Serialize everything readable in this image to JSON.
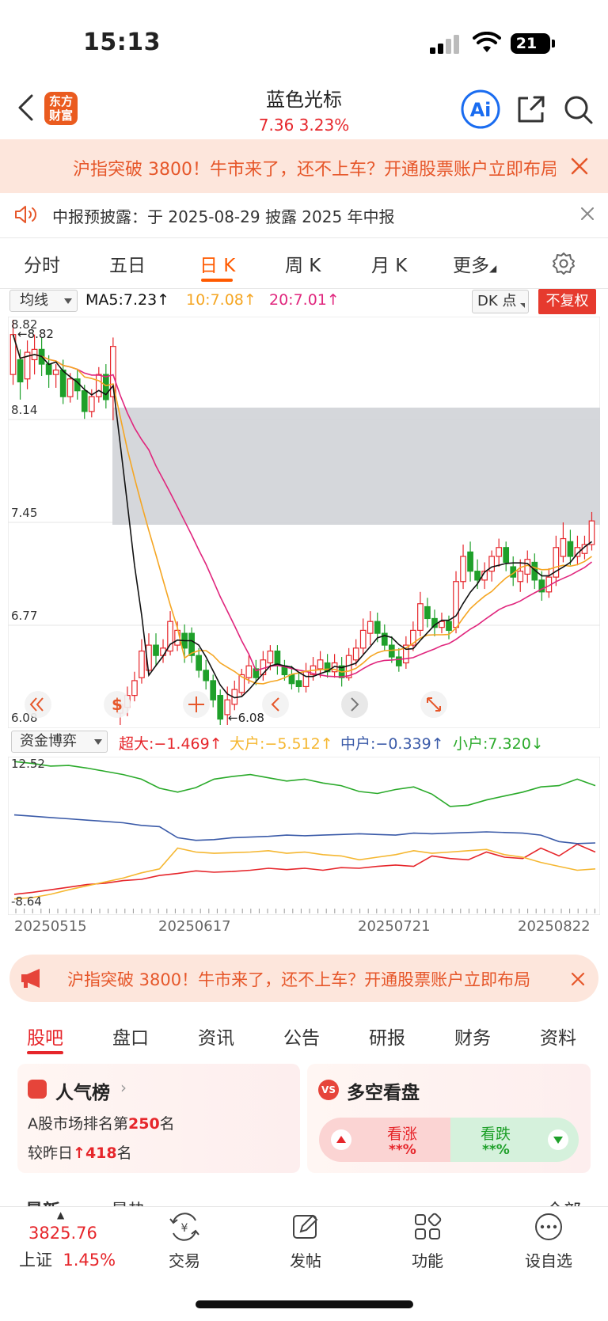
{
  "status_bar": {
    "time": "15:13",
    "battery": "21"
  },
  "header": {
    "logo_text_line1": "东方",
    "logo_text_line2": "财富",
    "title": "蓝色光标",
    "price": "7.36  3.23%",
    "ai_label": "Ai"
  },
  "banner": {
    "text": "沪指突破 3800！牛市来了，还不上车？开通股票账户立即布局"
  },
  "notice": {
    "text": "中报预披露：于 2025-08-29 披露 2025 年中报"
  },
  "chart_tabs": [
    {
      "label": "分时"
    },
    {
      "label": "五日"
    },
    {
      "label": "日 K"
    },
    {
      "label": "周 K"
    },
    {
      "label": "月 K"
    },
    {
      "label": "更多"
    }
  ],
  "ma_row": {
    "select": "均线",
    "ma5": "MA5:7.23↑",
    "ma10": "10:7.08↑",
    "ma20": "20:7.01↑",
    "dk": "DK 点",
    "adjust": "不复权"
  },
  "kline_labels": {
    "y_ticks": [
      "8.82",
      "8.14",
      "7.45",
      "6.77",
      "6.08"
    ],
    "high_marker": "←8.82",
    "low_marker": "←6.08"
  },
  "capital_row": {
    "select": "资金博弈",
    "super": "超大:−1.469↑",
    "large": "大户:−5.512↑",
    "medium": "中户:−0.339↑",
    "small": "小户:7.320↓"
  },
  "capital_labels": {
    "y_max": "12.52",
    "y_min": "-8.64"
  },
  "dates": [
    "20250515",
    "20250617",
    "20250721",
    "20250822"
  ],
  "colors": {
    "up": "#e6262b",
    "down": "#1fa02a",
    "ma5": "#111111",
    "ma10": "#f5a623",
    "ma20": "#e0267d",
    "super": "#e6262b",
    "large": "#f5b731",
    "medium": "#3a5aa8",
    "small": "#2aaa2a",
    "accent": "#ff5a00"
  },
  "chart_data": [
    {
      "type": "candlestick",
      "title": "",
      "ylim": [
        6.08,
        8.82
      ],
      "y_ticks": [
        8.82,
        8.14,
        7.45,
        6.77,
        6.08
      ],
      "x_ticks": [
        "20250515",
        "20250617",
        "20250721",
        "20250822"
      ],
      "candles": [
        {
          "o": 8.45,
          "c": 8.72,
          "h": 8.82,
          "l": 8.38
        },
        {
          "o": 8.55,
          "c": 8.4,
          "h": 8.62,
          "l": 8.28
        },
        {
          "o": 8.42,
          "c": 8.6,
          "h": 8.68,
          "l": 8.35
        },
        {
          "o": 8.55,
          "c": 8.62,
          "h": 8.72,
          "l": 8.45
        },
        {
          "o": 8.62,
          "c": 8.52,
          "h": 8.7,
          "l": 8.44
        },
        {
          "o": 8.52,
          "c": 8.45,
          "h": 8.58,
          "l": 8.36
        },
        {
          "o": 8.45,
          "c": 8.48,
          "h": 8.52,
          "l": 8.36
        },
        {
          "o": 8.48,
          "c": 8.3,
          "h": 8.55,
          "l": 8.25
        },
        {
          "o": 8.3,
          "c": 8.42,
          "h": 8.46,
          "l": 8.26
        },
        {
          "o": 8.42,
          "c": 8.34,
          "h": 8.48,
          "l": 8.28
        },
        {
          "o": 8.34,
          "c": 8.2,
          "h": 8.38,
          "l": 8.15
        },
        {
          "o": 8.2,
          "c": 8.3,
          "h": 8.35,
          "l": 8.16
        },
        {
          "o": 8.3,
          "c": 8.45,
          "h": 8.5,
          "l": 8.26
        },
        {
          "o": 8.45,
          "c": 8.28,
          "h": 8.52,
          "l": 8.22
        },
        {
          "o": 8.3,
          "c": 8.64,
          "h": 8.7,
          "l": 8.14
        },
        {
          "o": 6.16,
          "c": 6.22,
          "h": 6.26,
          "l": 6.08
        },
        {
          "o": 6.2,
          "c": 6.28,
          "h": 6.34,
          "l": 6.14
        },
        {
          "o": 6.28,
          "c": 6.38,
          "h": 6.44,
          "l": 6.24
        },
        {
          "o": 6.4,
          "c": 6.58,
          "h": 6.66,
          "l": 6.36
        },
        {
          "o": 6.45,
          "c": 6.62,
          "h": 6.7,
          "l": 6.42
        },
        {
          "o": 6.62,
          "c": 6.55,
          "h": 6.7,
          "l": 6.48
        },
        {
          "o": 6.55,
          "c": 6.6,
          "h": 6.66,
          "l": 6.5
        },
        {
          "o": 6.58,
          "c": 6.78,
          "h": 6.85,
          "l": 6.55
        },
        {
          "o": 6.62,
          "c": 6.72,
          "h": 6.78,
          "l": 6.58
        },
        {
          "o": 6.7,
          "c": 6.6,
          "h": 6.76,
          "l": 6.5
        },
        {
          "o": 6.7,
          "c": 6.55,
          "h": 6.74,
          "l": 6.5
        },
        {
          "o": 6.55,
          "c": 6.45,
          "h": 6.6,
          "l": 6.4
        },
        {
          "o": 6.45,
          "c": 6.38,
          "h": 6.52,
          "l": 6.32
        },
        {
          "o": 6.38,
          "c": 6.25,
          "h": 6.42,
          "l": 6.2
        },
        {
          "o": 6.28,
          "c": 6.12,
          "h": 6.32,
          "l": 6.08
        },
        {
          "o": 6.15,
          "c": 6.25,
          "h": 6.34,
          "l": 6.08
        },
        {
          "o": 6.22,
          "c": 6.32,
          "h": 6.38,
          "l": 6.18
        },
        {
          "o": 6.3,
          "c": 6.42,
          "h": 6.46,
          "l": 6.28
        },
        {
          "o": 6.4,
          "c": 6.48,
          "h": 6.55,
          "l": 6.36
        },
        {
          "o": 6.46,
          "c": 6.4,
          "h": 6.52,
          "l": 6.35
        },
        {
          "o": 6.42,
          "c": 6.52,
          "h": 6.58,
          "l": 6.38
        },
        {
          "o": 6.5,
          "c": 6.58,
          "h": 6.62,
          "l": 6.45
        },
        {
          "o": 6.58,
          "c": 6.48,
          "h": 6.62,
          "l": 6.42
        },
        {
          "o": 6.48,
          "c": 6.42,
          "h": 6.52,
          "l": 6.38
        },
        {
          "o": 6.42,
          "c": 6.36,
          "h": 6.48,
          "l": 6.32
        },
        {
          "o": 6.38,
          "c": 6.34,
          "h": 6.44,
          "l": 6.3
        },
        {
          "o": 6.34,
          "c": 6.44,
          "h": 6.5,
          "l": 6.3
        },
        {
          "o": 6.42,
          "c": 6.48,
          "h": 6.54,
          "l": 6.38
        },
        {
          "o": 6.46,
          "c": 6.52,
          "h": 6.58,
          "l": 6.4
        },
        {
          "o": 6.5,
          "c": 6.44,
          "h": 6.56,
          "l": 6.4
        },
        {
          "o": 6.44,
          "c": 6.5,
          "h": 6.56,
          "l": 6.4
        },
        {
          "o": 6.48,
          "c": 6.4,
          "h": 6.54,
          "l": 6.34
        },
        {
          "o": 6.4,
          "c": 6.55,
          "h": 6.6,
          "l": 6.38
        },
        {
          "o": 6.52,
          "c": 6.6,
          "h": 6.66,
          "l": 6.48
        },
        {
          "o": 6.6,
          "c": 6.72,
          "h": 6.8,
          "l": 6.56
        },
        {
          "o": 6.7,
          "c": 6.78,
          "h": 6.85,
          "l": 6.62
        },
        {
          "o": 6.78,
          "c": 6.7,
          "h": 6.84,
          "l": 6.64
        },
        {
          "o": 6.7,
          "c": 6.62,
          "h": 6.76,
          "l": 6.58
        },
        {
          "o": 6.62,
          "c": 6.54,
          "h": 6.68,
          "l": 6.5
        },
        {
          "o": 6.54,
          "c": 6.48,
          "h": 6.6,
          "l": 6.44
        },
        {
          "o": 6.5,
          "c": 6.62,
          "h": 6.68,
          "l": 6.46
        },
        {
          "o": 6.62,
          "c": 6.72,
          "h": 6.78,
          "l": 6.58
        },
        {
          "o": 6.72,
          "c": 6.9,
          "h": 6.98,
          "l": 6.68
        },
        {
          "o": 6.88,
          "c": 6.8,
          "h": 6.94,
          "l": 6.74
        },
        {
          "o": 6.8,
          "c": 6.74,
          "h": 6.86,
          "l": 6.68
        },
        {
          "o": 6.74,
          "c": 6.78,
          "h": 6.84,
          "l": 6.7
        },
        {
          "o": 6.78,
          "c": 6.72,
          "h": 6.82,
          "l": 6.66
        },
        {
          "o": 6.74,
          "c": 7.05,
          "h": 7.12,
          "l": 6.7
        },
        {
          "o": 7.05,
          "c": 7.22,
          "h": 7.3,
          "l": 7.0
        },
        {
          "o": 7.25,
          "c": 7.12,
          "h": 7.32,
          "l": 7.05
        },
        {
          "o": 7.12,
          "c": 7.06,
          "h": 7.2,
          "l": 7.0
        },
        {
          "o": 7.06,
          "c": 7.12,
          "h": 7.18,
          "l": 7.0
        },
        {
          "o": 7.12,
          "c": 7.22,
          "h": 7.26,
          "l": 7.05
        },
        {
          "o": 7.22,
          "c": 7.28,
          "h": 7.34,
          "l": 7.15
        },
        {
          "o": 7.28,
          "c": 7.18,
          "h": 7.32,
          "l": 7.12
        },
        {
          "o": 7.15,
          "c": 7.08,
          "h": 7.22,
          "l": 7.02
        },
        {
          "o": 7.05,
          "c": 7.12,
          "h": 7.2,
          "l": 6.98
        },
        {
          "o": 7.1,
          "c": 7.2,
          "h": 7.26,
          "l": 7.04
        },
        {
          "o": 7.18,
          "c": 7.06,
          "h": 7.24,
          "l": 7.0
        },
        {
          "o": 7.06,
          "c": 6.98,
          "h": 7.12,
          "l": 6.92
        },
        {
          "o": 6.98,
          "c": 7.08,
          "h": 7.14,
          "l": 6.94
        },
        {
          "o": 7.08,
          "c": 7.28,
          "h": 7.36,
          "l": 7.02
        },
        {
          "o": 7.22,
          "c": 7.34,
          "h": 7.45,
          "l": 7.18
        },
        {
          "o": 7.32,
          "c": 7.22,
          "h": 7.4,
          "l": 7.16
        },
        {
          "o": 7.22,
          "c": 7.28,
          "h": 7.36,
          "l": 7.16
        },
        {
          "o": 7.24,
          "c": 7.3,
          "h": 7.36,
          "l": 7.2
        },
        {
          "o": 7.3,
          "c": 7.46,
          "h": 7.52,
          "l": 7.26
        }
      ]
    },
    {
      "type": "line",
      "title": "资金博弈",
      "ylim": [
        -8.64,
        12.52
      ],
      "x_ticks": [
        "20250515",
        "20250617",
        "20250721",
        "20250822"
      ],
      "series": [
        {
          "name": "超大",
          "values": [
            -7.9,
            -7.6,
            -7.2,
            -6.8,
            -6.4,
            -6.2,
            -5.8,
            -5.6,
            -5.0,
            -4.7,
            -4.3,
            -4.5,
            -4.4,
            -4.2,
            -3.9,
            -4.1,
            -3.9,
            -4.2,
            -3.8,
            -3.9,
            -3.6,
            -3.4,
            -3.6,
            -2.0,
            -2.4,
            -2.6,
            -1.4,
            -2.2,
            -2.4,
            -0.8,
            -2.0,
            -0.2,
            -1.4
          ]
        },
        {
          "name": "大户",
          "values": [
            -8.6,
            -8.4,
            -7.9,
            -7.2,
            -6.6,
            -6.0,
            -5.4,
            -4.6,
            -4.0,
            -0.8,
            -1.4,
            -1.6,
            -1.5,
            -1.4,
            -1.2,
            -1.6,
            -1.4,
            -1.8,
            -2.0,
            -2.6,
            -2.2,
            -1.8,
            -1.2,
            -1.6,
            -1.4,
            -1.2,
            -1.0,
            -1.8,
            -2.2,
            -3.0,
            -3.6,
            -4.2,
            -4.0
          ]
        },
        {
          "name": "中户",
          "values": [
            4.3,
            4.1,
            3.9,
            3.7,
            3.5,
            3.3,
            3.1,
            2.7,
            2.5,
            0.8,
            0.4,
            0.5,
            0.8,
            0.9,
            1.0,
            1.2,
            1.1,
            1.2,
            1.3,
            1.4,
            1.3,
            1.2,
            1.5,
            1.4,
            1.5,
            1.6,
            1.7,
            1.6,
            1.5,
            1.2,
            0.2,
            -0.1,
            0.0
          ]
        },
        {
          "name": "小户",
          "values": [
            12.5,
            12.2,
            11.8,
            11.9,
            11.5,
            11.0,
            10.5,
            9.8,
            8.4,
            7.8,
            8.5,
            9.8,
            10.2,
            10.5,
            10.0,
            9.5,
            9.8,
            9.2,
            8.8,
            7.9,
            7.6,
            8.2,
            8.6,
            7.5,
            5.6,
            5.8,
            6.6,
            7.2,
            7.8,
            8.6,
            8.8,
            9.8,
            8.8
          ]
        }
      ]
    }
  ],
  "promo": {
    "text": "沪指突破 3800！牛市来了，还不上车？开通股票账户立即布局"
  },
  "bottom_tabs": [
    {
      "label": "股吧"
    },
    {
      "label": "盘口"
    },
    {
      "label": "资讯"
    },
    {
      "label": "公告"
    },
    {
      "label": "研报"
    },
    {
      "label": "财务"
    },
    {
      "label": "资料"
    }
  ],
  "popularity": {
    "title": "人气榜",
    "rank_prefix": "A股市场排名第",
    "rank_value": "250",
    "rank_suffix": "名",
    "change_prefix": "较昨日",
    "change_arrow": "↑",
    "change_value": "418",
    "change_suffix": "名"
  },
  "sentiment": {
    "vs_label": "VS",
    "title": "多空看盘",
    "up_label": "看涨",
    "up_pct": "**%",
    "down_label": "看跌",
    "down_pct": "**%"
  },
  "peek": {
    "left1": "最新",
    "left2": "最热",
    "right": "全部"
  },
  "bottom_bar": {
    "index_value": "3825.76",
    "index_name": "上证",
    "index_pct": "1.45%",
    "nav": [
      {
        "label": "交易",
        "icon": "trade-icon"
      },
      {
        "label": "发帖",
        "icon": "post-icon"
      },
      {
        "label": "功能",
        "icon": "grid-icon"
      },
      {
        "label": "设自选",
        "icon": "more-icon"
      }
    ]
  }
}
